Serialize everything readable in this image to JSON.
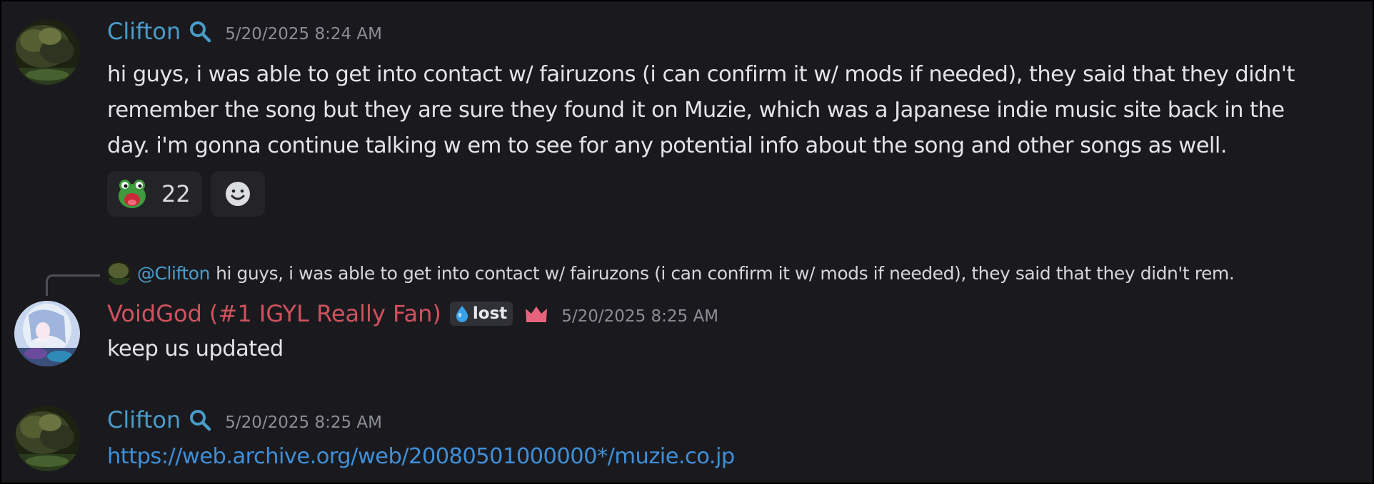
{
  "messages": [
    {
      "username": "Clifton",
      "timestamp": "5/20/2025 8:24 AM",
      "lines": [
        "hi guys, i was able to get into contact w/ fairuzons (i can confirm it w/ mods if needed), they said that they didn't",
        "remember the song but they are sure they found it on Muzie, which was a Japanese indie music site back in the",
        "day. i'm gonna continue talking w em to see for any potential info about the song and other songs as well."
      ],
      "reaction": {
        "emoji": "frog-emoji",
        "count": "22"
      }
    },
    {
      "reply": {
        "mention": "@Clifton",
        "text": "hi guys, i was able to get into contact w/ fairuzons (i can confirm it w/ mods if needed), they said that they didn't rem."
      },
      "username": "VoidGod (#1 IGYL Really Fan)",
      "tag": "lost",
      "timestamp": "5/20/2025 8:25 AM",
      "text": "keep us updated"
    },
    {
      "username": "Clifton",
      "timestamp": "5/20/2025 8:25 AM",
      "link": "https://web.archive.org/web/20080501000000*/muzie.co.jp"
    }
  ],
  "colors": {
    "background": "#1a1a1e",
    "clifton_name": "#4a9cc9",
    "voidgod_name": "#d0525e",
    "link": "#3f8fd8",
    "crown": "#e8637c"
  },
  "icons": [
    "search-icon",
    "frog-emoji",
    "add-reaction-icon",
    "water-drop-icon",
    "crown-icon"
  ]
}
